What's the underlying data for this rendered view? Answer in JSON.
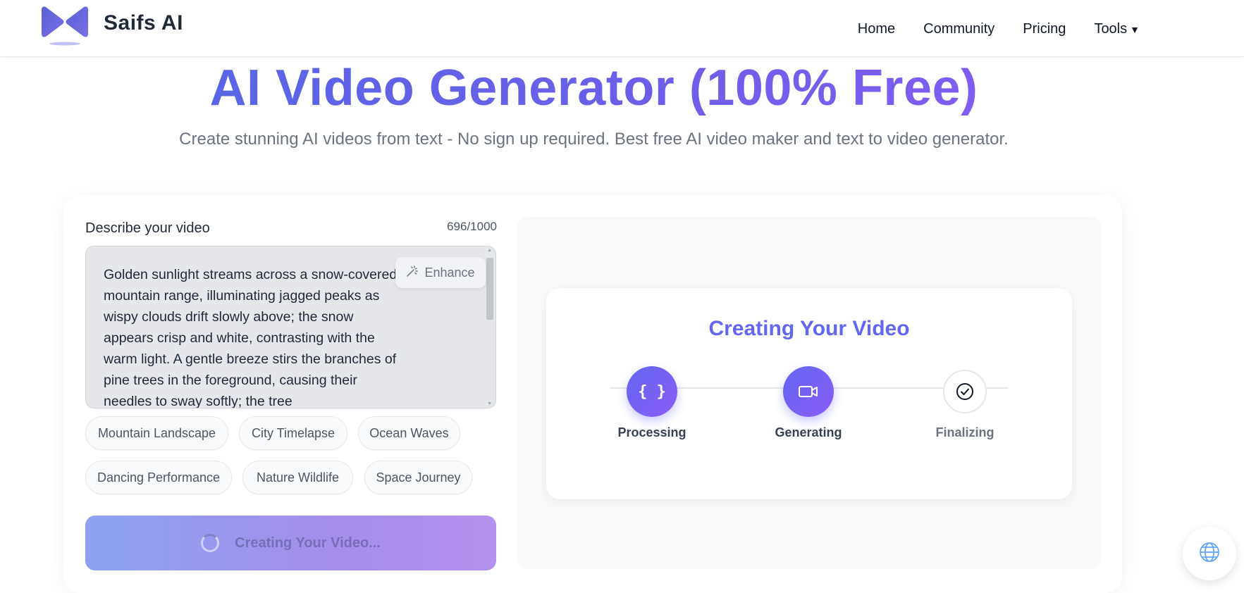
{
  "header": {
    "brand": "Saifs AI",
    "nav": [
      {
        "label": "Home"
      },
      {
        "label": "Community"
      },
      {
        "label": "Pricing"
      },
      {
        "label": "Tools"
      }
    ]
  },
  "hero": {
    "title": "AI Video Generator (100% Free)",
    "subtitle": "Create stunning AI videos from text - No sign up required. Best free AI video maker and text to video generator."
  },
  "form": {
    "label": "Describe your video",
    "char_count": "696/1000",
    "prompt_text": "Golden sunlight streams across a snow-covered mountain range, illuminating jagged peaks as wispy clouds drift slowly above; the snow appears crisp and white, contrasting with the warm light. A gentle breeze stirs the branches of pine trees in the foreground, causing their needles to sway softly; the tree",
    "enhance_label": "Enhance",
    "chips": [
      "Mountain Landscape",
      "City Timelapse",
      "Ocean Waves",
      "Dancing Performance",
      "Nature Wildlife",
      "Space Journey"
    ],
    "submit_label": "Creating Your Video..."
  },
  "progress": {
    "title": "Creating Your Video",
    "steps": [
      {
        "label": "Processing",
        "state": "active",
        "icon": "code-braces-icon"
      },
      {
        "label": "Generating",
        "state": "active",
        "icon": "video-camera-icon"
      },
      {
        "label": "Finalizing",
        "state": "pending",
        "icon": "check-circle-icon"
      }
    ]
  },
  "colors": {
    "accent": "#6366f1",
    "accent_secondary": "#8b5cf6",
    "title_gradient_start": "#4f6ae6",
    "title_gradient_end": "#8b5cf6"
  },
  "widgets": {
    "language_icon": "globe-icon"
  }
}
